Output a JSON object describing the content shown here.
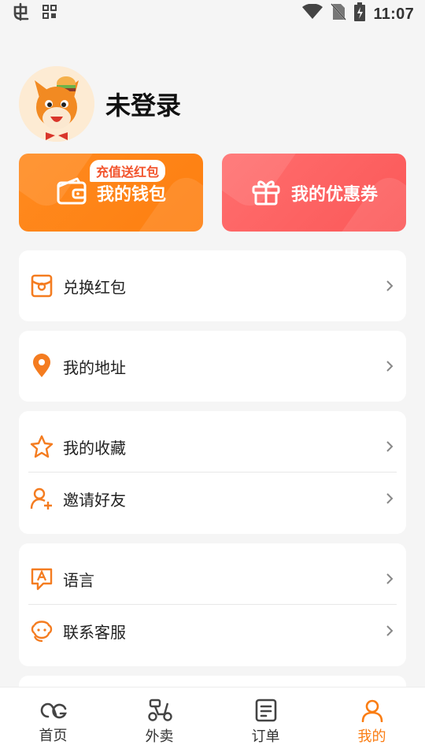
{
  "status_bar": {
    "time": "11:07",
    "icons": [
      "app-logo-icon",
      "qr-grid-icon",
      "wifi-icon",
      "no-sim-icon",
      "battery-charging-icon"
    ]
  },
  "profile": {
    "name": "未登录",
    "avatar": "horse-mascot-avatar"
  },
  "cards": {
    "wallet": {
      "label": "我的钱包",
      "badge": "充值送红包",
      "icon": "wallet-icon",
      "color": "#fe8414"
    },
    "coupon": {
      "label": "我的优惠券",
      "icon": "gift-icon",
      "color": "#fd5d5d"
    }
  },
  "menu": {
    "redeem": {
      "label": "兑换红包",
      "icon": "red-packet-icon"
    },
    "address": {
      "label": "我的地址",
      "icon": "location-pin-icon"
    },
    "favorites": {
      "label": "我的收藏",
      "icon": "star-icon"
    },
    "invite": {
      "label": "邀请好友",
      "icon": "add-user-icon"
    },
    "language": {
      "label": "语言",
      "icon": "language-icon"
    },
    "support": {
      "label": "联系客服",
      "icon": "customer-service-icon"
    }
  },
  "bottom_nav": {
    "items": [
      {
        "label": "首页",
        "icon": "home-logo-icon",
        "active": false
      },
      {
        "label": "外卖",
        "icon": "scooter-icon",
        "active": false
      },
      {
        "label": "订单",
        "icon": "order-list-icon",
        "active": false
      },
      {
        "label": "我的",
        "icon": "profile-icon",
        "active": true
      }
    ]
  },
  "colors": {
    "accent": "#fa7d13",
    "wallet_orange": "#fe8414",
    "coupon_red": "#fd5d5d",
    "background": "#f5f5f5"
  }
}
